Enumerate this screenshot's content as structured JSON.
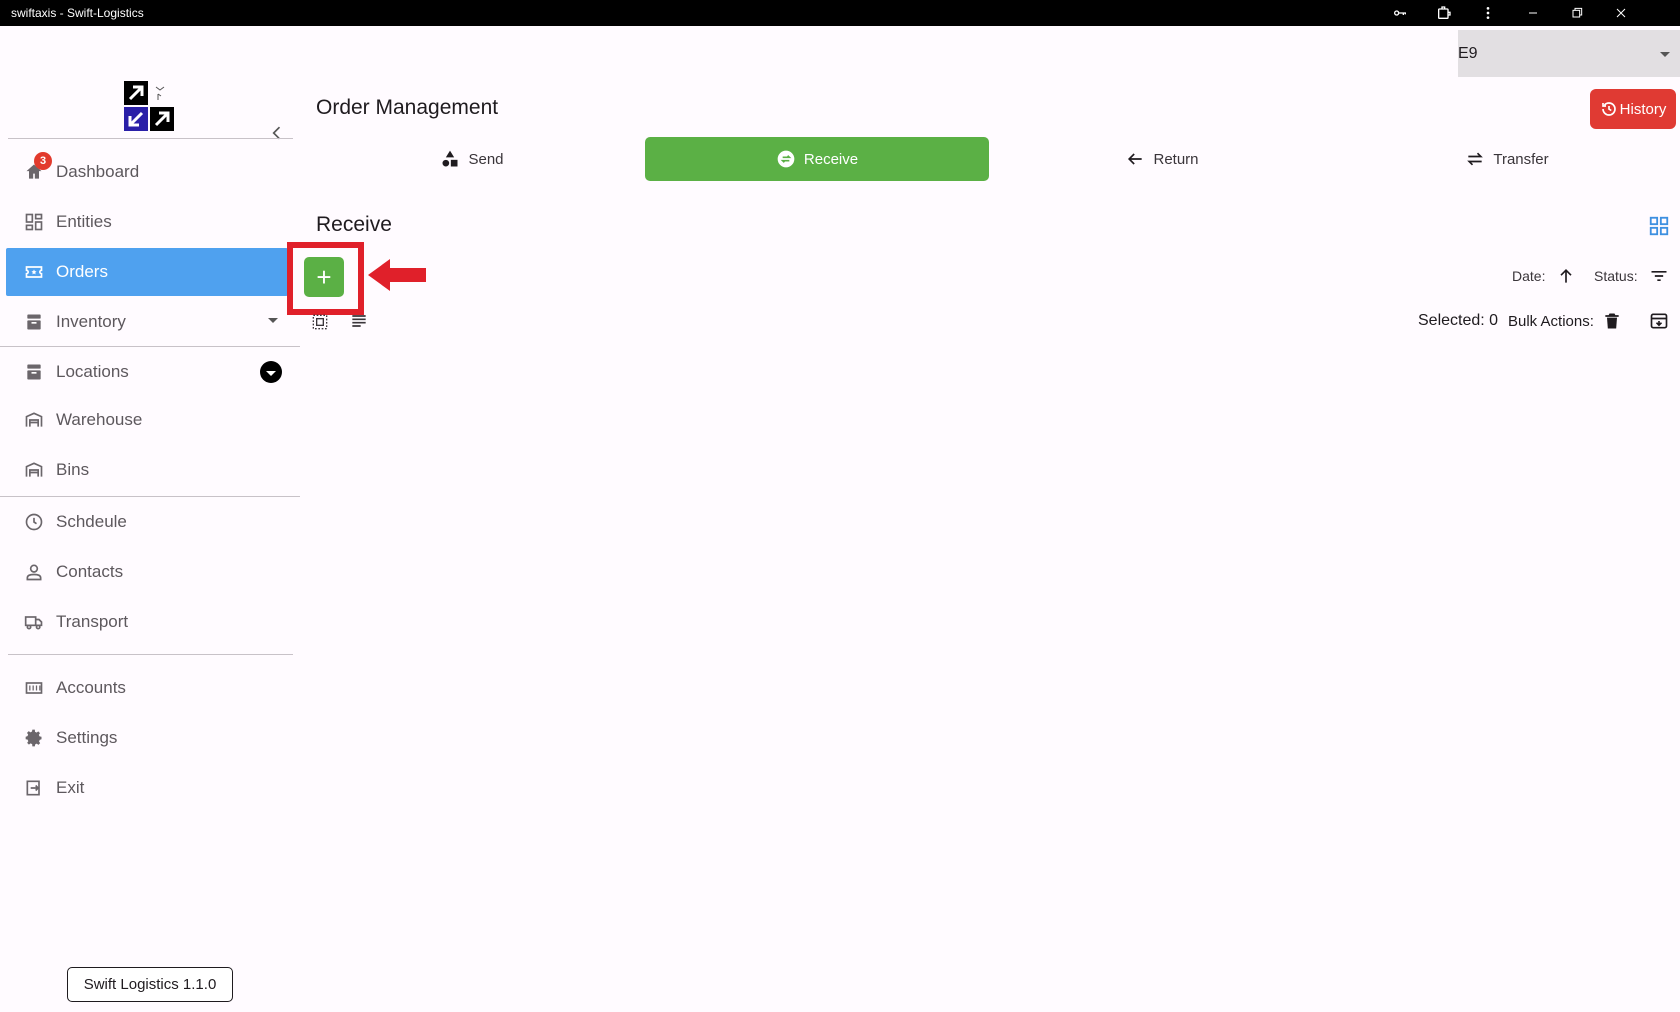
{
  "window": {
    "title": "swiftaxis - Swift-Logistics",
    "controls": [
      "key-icon",
      "extension-icon",
      "more-icon",
      "minimize-icon",
      "restore-icon",
      "close-icon"
    ]
  },
  "sidebar": {
    "items": [
      {
        "label": "Dashboard",
        "icon": "home-icon",
        "badge": "3"
      },
      {
        "label": "Entities",
        "icon": "dashboard-grid-icon"
      },
      {
        "label": "Orders",
        "icon": "ticket-icon",
        "active": true
      },
      {
        "label": "Inventory",
        "icon": "inventory-icon",
        "expandable": true
      },
      {
        "label": "Locations",
        "icon": "locations-icon",
        "expandable": true
      },
      {
        "label": "Warehouse",
        "icon": "warehouse-icon"
      },
      {
        "label": "Bins",
        "icon": "warehouse-icon"
      },
      {
        "label": "Schdeule",
        "icon": "clock-icon"
      },
      {
        "label": "Contacts",
        "icon": "person-icon"
      },
      {
        "label": "Transport",
        "icon": "truck-icon"
      },
      {
        "label": "Accounts",
        "icon": "counter-icon"
      },
      {
        "label": "Settings",
        "icon": "gear-icon"
      },
      {
        "label": "Exit",
        "icon": "exit-icon"
      }
    ],
    "version": "Swift Logistics 1.1.0"
  },
  "header": {
    "selector_value": "E9",
    "page_title": "Order Management",
    "history_label": "History"
  },
  "tabs": [
    {
      "label": "Send",
      "icon": "shapes-icon"
    },
    {
      "label": "Receive",
      "icon": "swap-circle-icon",
      "active": true
    },
    {
      "label": "Return",
      "icon": "arrow-left-icon"
    },
    {
      "label": "Transfer",
      "icon": "transfer-icon"
    }
  ],
  "section": {
    "title": "Receive",
    "add_label": "+",
    "date_label": "Date:",
    "status_label": "Status:",
    "selected_text": "Selected: 0",
    "bulk_actions_label": "Bulk Actions:"
  },
  "colors": {
    "accent_green": "#5bb045",
    "active_blue": "#4fa1ef",
    "history_red": "#e03a33",
    "highlight_red": "#e0202a"
  }
}
